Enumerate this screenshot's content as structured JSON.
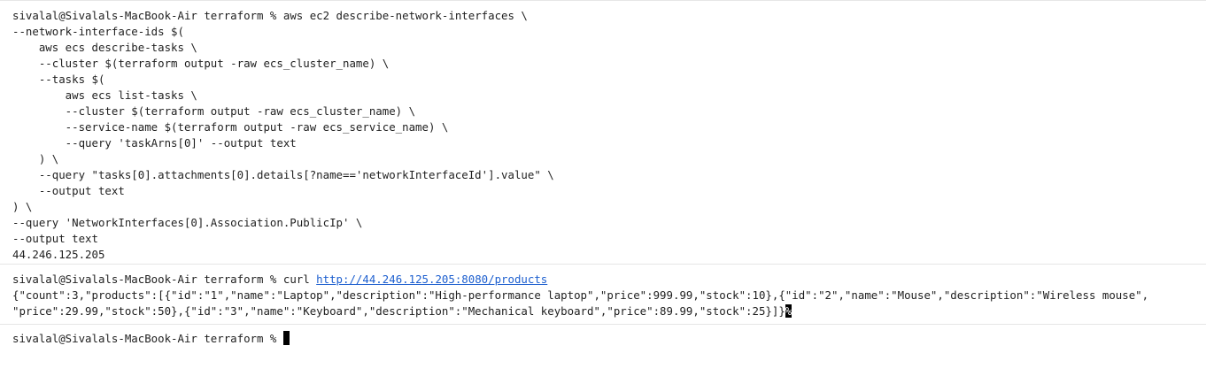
{
  "block1": {
    "prompt": "sivalal@Sivalals-MacBook-Air terraform % ",
    "lines": [
      "aws ec2 describe-network-interfaces \\",
      "--network-interface-ids $(",
      "    aws ecs describe-tasks \\",
      "    --cluster $(terraform output -raw ecs_cluster_name) \\",
      "    --tasks $(",
      "        aws ecs list-tasks \\",
      "        --cluster $(terraform output -raw ecs_cluster_name) \\",
      "        --service-name $(terraform output -raw ecs_service_name) \\",
      "        --query 'taskArns[0]' --output text",
      "    ) \\",
      "    --query \"tasks[0].attachments[0].details[?name=='networkInterfaceId'].value\" \\",
      "    --output text",
      ") \\",
      "--query 'NetworkInterfaces[0].Association.PublicIp' \\",
      "--output text"
    ],
    "output": "44.246.125.205"
  },
  "block2": {
    "prompt": "sivalal@Sivalals-MacBook-Air terraform % ",
    "command": "curl ",
    "url": "http://44.246.125.205:8080/products",
    "output_line1": "{\"count\":3,\"products\":[{\"id\":\"1\",\"name\":\"Laptop\",\"description\":\"High-performance laptop\",\"price\":999.99,\"stock\":10},{\"id\":\"2\",\"name\":\"Mouse\",\"description\":\"Wireless mouse\",",
    "output_line2": "\"price\":29.99,\"stock\":50},{\"id\":\"3\",\"name\":\"Keyboard\",\"description\":\"Mechanical keyboard\",\"price\":89.99,\"stock\":25}]}",
    "eol_mark": "%"
  },
  "block3": {
    "prompt": "sivalal@Sivalals-MacBook-Air terraform % "
  }
}
